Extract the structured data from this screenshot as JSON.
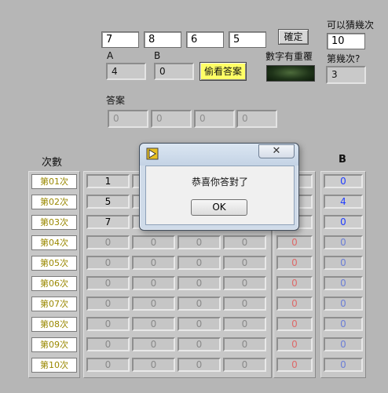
{
  "inputs": {
    "guess": [
      "7",
      "8",
      "6",
      "5"
    ],
    "max_label": "可以猜幾次",
    "max_value": "10",
    "confirm_label": "確定",
    "peek_label": "偷看答案",
    "dup_label": "數字有重覆",
    "a_label": "A",
    "b_label": "B",
    "a_value": "4",
    "b_value": "0",
    "which_label": "第幾次?",
    "which_value": "3",
    "answer_label": "答案",
    "answer": [
      "0",
      "0",
      "0",
      "0"
    ]
  },
  "table": {
    "count_header": "次數",
    "b_header": "B",
    "rounds": [
      "第01次",
      "第02次",
      "第03次",
      "第04次",
      "第05次",
      "第06次",
      "第07次",
      "第08次",
      "第09次",
      "第10次"
    ],
    "rows": [
      {
        "d": [
          "1",
          "",
          "",
          ""
        ],
        "a": "",
        "b": "0"
      },
      {
        "d": [
          "5",
          "",
          "",
          ""
        ],
        "a": "",
        "b": "4"
      },
      {
        "d": [
          "7",
          "",
          "",
          ""
        ],
        "a": "",
        "b": "0"
      },
      {
        "d": [
          "0",
          "0",
          "0",
          "0"
        ],
        "a": "0",
        "b": "0"
      },
      {
        "d": [
          "0",
          "0",
          "0",
          "0"
        ],
        "a": "0",
        "b": "0"
      },
      {
        "d": [
          "0",
          "0",
          "0",
          "0"
        ],
        "a": "0",
        "b": "0"
      },
      {
        "d": [
          "0",
          "0",
          "0",
          "0"
        ],
        "a": "0",
        "b": "0"
      },
      {
        "d": [
          "0",
          "0",
          "0",
          "0"
        ],
        "a": "0",
        "b": "0"
      },
      {
        "d": [
          "0",
          "0",
          "0",
          "0"
        ],
        "a": "0",
        "b": "0"
      },
      {
        "d": [
          "0",
          "0",
          "0",
          "0"
        ],
        "a": "0",
        "b": "0"
      }
    ],
    "filled_rows": 3
  },
  "dialog": {
    "message": "恭喜你答對了",
    "ok_label": "OK",
    "close_glyph": "✕",
    "title_icon": "labview-icon"
  },
  "colors": {
    "background": "#b6b6b6",
    "peek_button": "#ffff66",
    "round_text": "#9a8800",
    "a_text": "#dd6a6a",
    "b_text": "#1f3cff"
  }
}
